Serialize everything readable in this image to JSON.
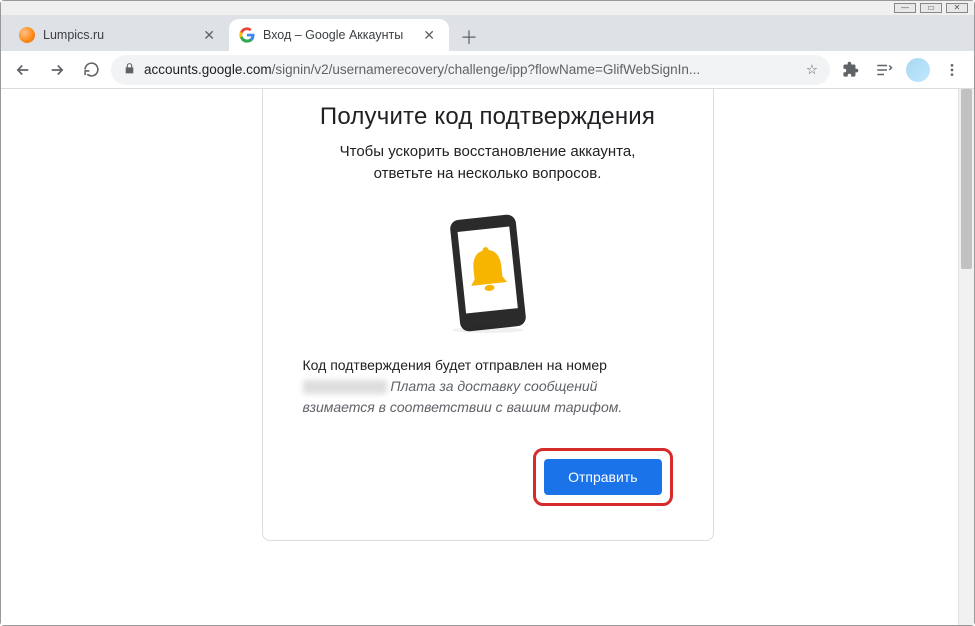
{
  "tabs": [
    {
      "title": "Lumpics.ru",
      "favicon": "orange"
    },
    {
      "title": "Вход – Google Аккаунты",
      "favicon": "google"
    }
  ],
  "addressbar": {
    "domain": "accounts.google.com",
    "path": "/signin/v2/usernamerecovery/challenge/ipp?flowName=GlifWebSignIn..."
  },
  "card": {
    "heading": "Получите код подтверждения",
    "subheading_line1": "Чтобы ускорить восстановление аккаунта,",
    "subheading_line2": "ответьте на несколько вопросов.",
    "desc_line1": "Код подтверждения будет отправлен на номер",
    "desc_blurred_placeholder": "••• ••••••",
    "desc_italic": "Плата за доставку сообщений взимается в соответствии с вашим тарифом.",
    "send_button": "Отправить"
  }
}
